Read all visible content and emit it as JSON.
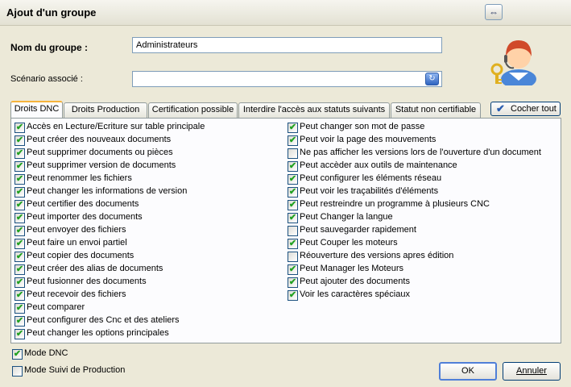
{
  "window": {
    "title": "Ajout d'un groupe"
  },
  "form": {
    "group_name_label": "Nom du groupe :",
    "group_name_value": "Administrateurs",
    "scenario_label": "Scénario associé :",
    "scenario_value": ""
  },
  "tabs": [
    {
      "label": "Droits DNC",
      "active": true
    },
    {
      "label": "Droits Production",
      "active": false
    },
    {
      "label": "Certification possible",
      "active": false
    },
    {
      "label": "Interdire l'accès aux statuts suivants",
      "active": false
    },
    {
      "label": "Statut non certifiable",
      "active": false
    }
  ],
  "check_all_label": "Cocher tout",
  "permissions_left": [
    {
      "label": "Accès en Lecture/Ecriture sur table principale",
      "checked": true
    },
    {
      "label": "Peut créer des nouveaux documents",
      "checked": true
    },
    {
      "label": "Peut supprimer documents ou pièces",
      "checked": true
    },
    {
      "label": "Peut supprimer version de documents",
      "checked": true
    },
    {
      "label": "Peut renommer les fichiers",
      "checked": true
    },
    {
      "label": "Peut changer les informations de version",
      "checked": true
    },
    {
      "label": "Peut certifier des documents",
      "checked": true
    },
    {
      "label": "Peut importer des documents",
      "checked": true
    },
    {
      "label": "Peut envoyer des fichiers",
      "checked": true
    },
    {
      "label": "Peut faire un envoi partiel",
      "checked": true
    },
    {
      "label": "Peut copier des documents",
      "checked": true
    },
    {
      "label": "Peut créer des alias de documents",
      "checked": true
    },
    {
      "label": "Peut fusionner des documents",
      "checked": true
    },
    {
      "label": "Peut recevoir des fichiers",
      "checked": true
    },
    {
      "label": "Peut comparer",
      "checked": true
    },
    {
      "label": "Peut configurer des Cnc et des ateliers",
      "checked": true
    },
    {
      "label": "Peut changer les options principales",
      "checked": true
    }
  ],
  "permissions_right": [
    {
      "label": "Peut changer son mot de passe",
      "checked": true
    },
    {
      "label": "Peut voir la page des mouvements",
      "checked": true
    },
    {
      "label": "Ne pas afficher les versions lors de l'ouverture d'un document",
      "checked": false
    },
    {
      "label": "Peut accèder aux outils de maintenance",
      "checked": true
    },
    {
      "label": "Peut configurer les éléments réseau",
      "checked": true
    },
    {
      "label": "Peut voir les traçabilités d'éléments",
      "checked": true
    },
    {
      "label": "Peut restreindre un programme à plusieurs CNC",
      "checked": true
    },
    {
      "label": "Peut Changer la langue",
      "checked": true
    },
    {
      "label": "Peut sauvegarder rapidement",
      "checked": false
    },
    {
      "label": "Peut Couper les moteurs",
      "checked": true
    },
    {
      "label": "Réouverture des versions apres édition",
      "checked": false
    },
    {
      "label": "Peut Manager les Moteurs",
      "checked": true
    },
    {
      "label": "Peut ajouter des documents",
      "checked": true
    },
    {
      "label": "Voir les caractères spéciaux",
      "checked": true
    }
  ],
  "modes": [
    {
      "label": "Mode DNC",
      "checked": true
    },
    {
      "label": "Mode Suivi de Production",
      "checked": false
    }
  ],
  "buttons": {
    "ok": "OK",
    "cancel": "Annuler"
  }
}
